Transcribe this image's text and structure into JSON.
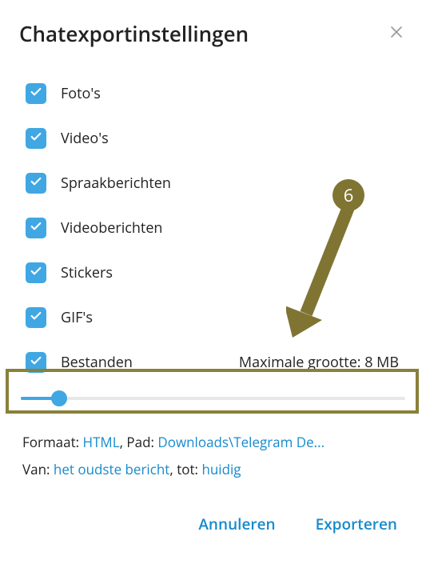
{
  "title": "Chatexportinstellingen",
  "options": [
    {
      "label": "Foto's",
      "checked": true
    },
    {
      "label": "Video's",
      "checked": true
    },
    {
      "label": "Spraakberichten",
      "checked": true
    },
    {
      "label": "Videoberichten",
      "checked": true
    },
    {
      "label": "Stickers",
      "checked": true
    },
    {
      "label": "GIF's",
      "checked": true
    },
    {
      "label": "Bestanden",
      "checked": true
    }
  ],
  "max_size_label": "Maximale grootte: 8 MB",
  "slider": {
    "percent": 10
  },
  "info": {
    "format_label": "Formaat",
    "format_value": "HTML",
    "path_label": "Pad",
    "path_value": "Downloads\\Telegram De...",
    "from_label": "Van",
    "from_value": "het oudste bericht",
    "to_label": "tot",
    "to_value": "huidig"
  },
  "buttons": {
    "cancel": "Annuleren",
    "export": "Exporteren"
  },
  "annotation": {
    "number": "6"
  }
}
